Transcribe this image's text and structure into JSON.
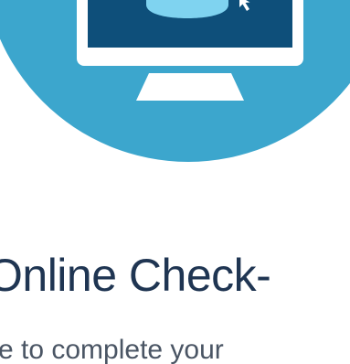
{
  "hero": {
    "icon": "monitor-icon",
    "circle_color": "#3ca6cd",
    "screen_color": "#0e4f7a",
    "frame_color": "#ffffff",
    "accent_color": "#7fd3f0"
  },
  "heading": {
    "title": "Online Check-",
    "subtitle": "re to complete your"
  }
}
